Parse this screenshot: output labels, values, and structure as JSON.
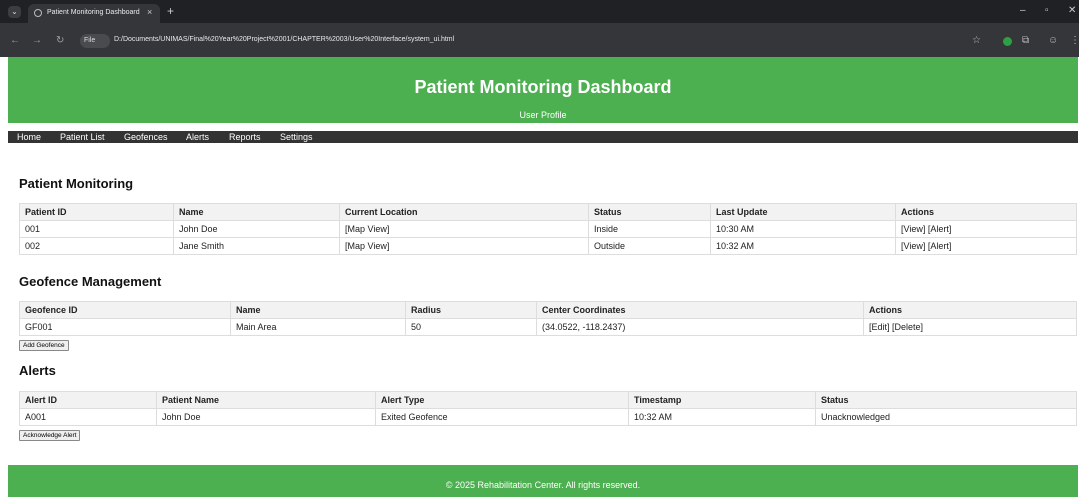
{
  "browser": {
    "tab_title": "Patient Monitoring Dashboard",
    "tab_close": "×",
    "new_tab": "+",
    "site_info": "File",
    "url": "D:/Documents/UNIMAS/Final%20Year%20Project%2001/CHAPTER%2003/User%20Interface/system_ui.html"
  },
  "header": {
    "title": "Patient Monitoring Dashboard",
    "subtitle": "User Profile"
  },
  "nav": {
    "items": [
      "Home",
      "Patient List",
      "Geofences",
      "Alerts",
      "Reports",
      "Settings"
    ]
  },
  "patients": {
    "title": "Patient Monitoring",
    "columns": [
      "Patient ID",
      "Name",
      "Current Location",
      "Status",
      "Last Update",
      "Actions"
    ],
    "rows": [
      [
        "001",
        "John Doe",
        "[Map View]",
        "Inside",
        "10:30 AM",
        "[View] [Alert]"
      ],
      [
        "002",
        "Jane Smith",
        "[Map View]",
        "Outside",
        "10:32 AM",
        "[View] [Alert]"
      ]
    ]
  },
  "geofences": {
    "title": "Geofence Management",
    "columns": [
      "Geofence ID",
      "Name",
      "Radius",
      "Center Coordinates",
      "Actions"
    ],
    "rows": [
      [
        "GF001",
        "Main Area",
        "50",
        "(34.0522, -118.2437)",
        "[Edit] [Delete]"
      ]
    ],
    "add_button": "Add Geofence"
  },
  "alerts": {
    "title": "Alerts",
    "columns": [
      "Alert ID",
      "Patient Name",
      "Alert Type",
      "Timestamp",
      "Status"
    ],
    "rows": [
      [
        "A001",
        "John Doe",
        "Exited Geofence",
        "10:32 AM",
        "Unacknowledged"
      ]
    ],
    "ack_button": "Acknowledge Alert"
  },
  "footer": {
    "text": "© 2025 Rehabilitation Center. All rights reserved."
  },
  "colors": {
    "brand_green": "#4caf50",
    "nav_dark": "#333333",
    "browser_dark": "#202124"
  }
}
